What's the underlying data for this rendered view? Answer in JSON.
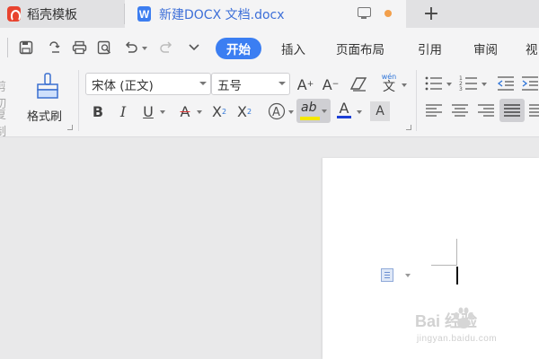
{
  "tabs": [
    {
      "label": "稻壳模板",
      "icon": "docer-logo-icon"
    },
    {
      "label": "新建DOCX 文档.docx",
      "icon": "wps-writer-icon"
    }
  ],
  "tab_status_color": "#f29f4b",
  "new_tab_label": "+",
  "quick_access": [
    "save-icon",
    "export-icon",
    "print-icon",
    "print-preview-icon",
    "undo-icon",
    "redo-icon",
    "more-dropdown-icon"
  ],
  "menu": {
    "items": [
      "开始",
      "插入",
      "页面布局",
      "引用",
      "审阅",
      "视"
    ],
    "active_index": 0,
    "accent_color": "#3b7ef2"
  },
  "clipboard": {
    "cut_label": "剪切",
    "copy_label": "复制",
    "format_painter_label": "格式刷"
  },
  "font": {
    "family_value": "宋体 (正文)",
    "size_value": "五号"
  },
  "format_buttons": {
    "bold": "B",
    "italic": "I",
    "underline": "U",
    "strike": "A",
    "superscript": "X",
    "subscript": "X",
    "pinyin": "wén",
    "highlight": "ab",
    "font_color": "A",
    "char_shading": "A"
  },
  "watermark": {
    "text": "Bai  经验",
    "url": "jingyan.baidu.com"
  }
}
